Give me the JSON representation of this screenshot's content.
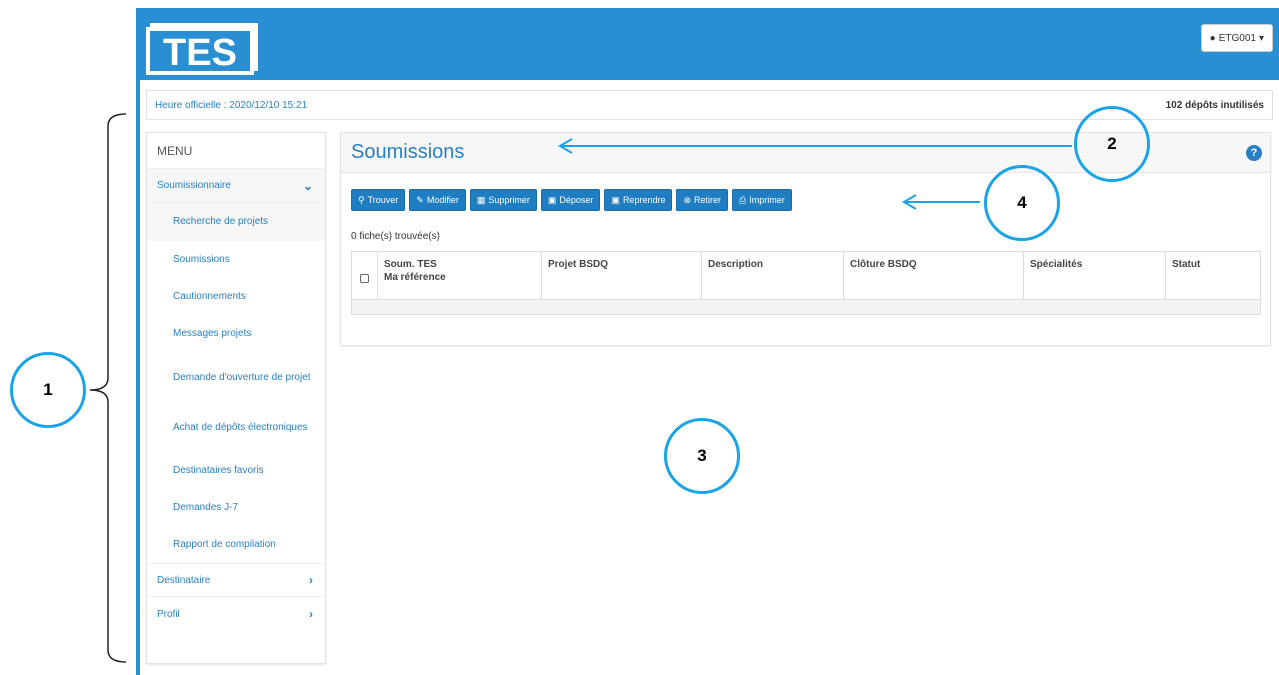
{
  "header": {
    "logo_text": "TES",
    "user_menu_label": "ETG001"
  },
  "info_bar": {
    "official_time": "Heure officielle : 2020/12/10 15:21",
    "unused_deposits": "102 dépôts inutilisés"
  },
  "sidebar": {
    "title": "MENU",
    "groups": [
      {
        "label": "Soumissionnaire",
        "expanded": true,
        "items": [
          {
            "label": "Recherche de projets"
          },
          {
            "label": "Soumissions"
          },
          {
            "label": "Cautionnements"
          },
          {
            "label": "Messages projets"
          },
          {
            "label": "Demande d'ouverture de projet"
          },
          {
            "label": "Achat de dépôts électroniques"
          },
          {
            "label": "Destinataires favoris"
          },
          {
            "label": "Demandes J-7"
          },
          {
            "label": "Rapport de compilation"
          }
        ]
      },
      {
        "label": "Destinataire",
        "expanded": false
      },
      {
        "label": "Profil",
        "expanded": false
      }
    ]
  },
  "main": {
    "title": "Soumissions",
    "toolbar": {
      "buttons": [
        {
          "label": "Trouver",
          "icon": "search-icon"
        },
        {
          "label": "Modifier",
          "icon": "pencil-icon"
        },
        {
          "label": "Supprimer",
          "icon": "trash-icon"
        },
        {
          "label": "Déposer",
          "icon": "lock-icon"
        },
        {
          "label": "Reprendre",
          "icon": "unlock-icon"
        },
        {
          "label": "Retirer",
          "icon": "remove-icon"
        },
        {
          "label": "Imprimer",
          "icon": "print-icon"
        }
      ]
    },
    "results_count": "0 fiche(s) trouvée(s)",
    "table": {
      "columns": [
        {
          "line1": "Soum. TES",
          "line2": "Ma référence"
        },
        {
          "line1": "Projet BSDQ",
          "line2": ""
        },
        {
          "line1": "Description",
          "line2": ""
        },
        {
          "line1": "Clôture BSDQ",
          "line2": ""
        },
        {
          "line1": "Spécialités",
          "line2": ""
        },
        {
          "line1": "Statut",
          "line2": ""
        }
      ]
    }
  },
  "annotations": [
    "1",
    "2",
    "3",
    "4"
  ],
  "colors": {
    "brand_blue": "#2a8fd2",
    "button_blue": "#1f7dc2",
    "link_blue": "#2a7fc4",
    "annotation_circle": "#1aa3e8"
  }
}
